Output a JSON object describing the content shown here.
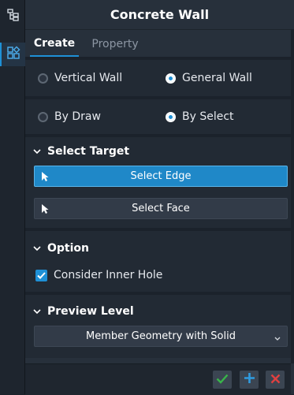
{
  "rail": {
    "items": [
      {
        "icon": "tree-hierarchy-icon"
      },
      {
        "icon": "grid-shapes-icon"
      }
    ]
  },
  "panel": {
    "title": "Concrete Wall",
    "tabs": [
      {
        "label": "Create"
      },
      {
        "label": "Property"
      }
    ],
    "wall_type": {
      "options": [
        {
          "label": "Vertical Wall"
        },
        {
          "label": "General Wall"
        }
      ],
      "selected": "General Wall"
    },
    "method": {
      "options": [
        {
          "label": "By Draw"
        },
        {
          "label": "By Select"
        }
      ],
      "selected": "By Select"
    },
    "select_target": {
      "title": "Select Target",
      "buttons": [
        {
          "label": "Select Edge"
        },
        {
          "label": "Select Face"
        }
      ]
    },
    "option": {
      "title": "Option",
      "checkbox_label": "Consider Inner Hole",
      "checked": true
    },
    "preview_level": {
      "title": "Preview Level",
      "value": "Member Geometry with Solid"
    }
  },
  "footer": {
    "buttons": [
      {
        "icon": "check-icon"
      },
      {
        "icon": "plus-icon"
      },
      {
        "icon": "close-icon"
      }
    ]
  },
  "colors": {
    "accent": "#1e90d6",
    "confirm": "#39b54a",
    "cancel": "#e04040"
  }
}
